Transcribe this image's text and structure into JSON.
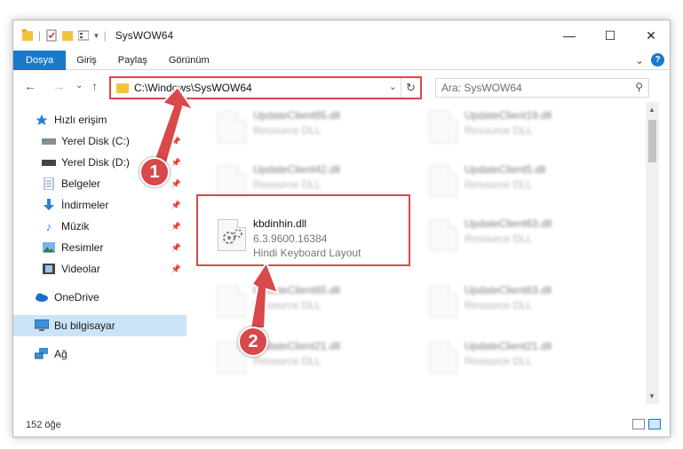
{
  "window": {
    "title": "SysWOW64",
    "controls": {
      "minimize": "—",
      "maximize": "☐",
      "close": "✕"
    }
  },
  "ribbon": {
    "tabs": [
      "Dosya",
      "Giriş",
      "Paylaş",
      "Görünüm"
    ],
    "active_tab": "Dosya",
    "expand": "⌄",
    "help": "?"
  },
  "navbar": {
    "back": "←",
    "forward": "→",
    "recent": "⌄",
    "up": "↑",
    "address": "C:\\Windows\\SysWOW64",
    "search_placeholder": "Ara: SysWOW64"
  },
  "sidebar": {
    "items": [
      {
        "label": "Hızlı erişim",
        "icon": "star-icon",
        "pinned": false
      },
      {
        "label": "Yerel Disk (C:)",
        "icon": "drive-icon",
        "pinned": true
      },
      {
        "label": "Yerel Disk (D:)",
        "icon": "drive-icon",
        "pinned": true
      },
      {
        "label": "Belgeler",
        "icon": "document-icon",
        "pinned": true
      },
      {
        "label": "İndirmeler",
        "icon": "download-icon",
        "pinned": true
      },
      {
        "label": "Müzik",
        "icon": "music-icon",
        "pinned": true
      },
      {
        "label": "Resimler",
        "icon": "pictures-icon",
        "pinned": true
      },
      {
        "label": "Videolar",
        "icon": "video-icon",
        "pinned": true
      },
      {
        "label": "OneDrive",
        "icon": "cloud-icon",
        "pinned": false
      },
      {
        "label": "Bu bilgisayar",
        "icon": "computer-icon",
        "pinned": false,
        "selected": true
      },
      {
        "label": "Ağ",
        "icon": "network-icon",
        "pinned": false
      }
    ]
  },
  "files": {
    "col1": [
      {
        "name": "UpdateClient65.dll",
        "desc": "Resource DLL"
      },
      {
        "name": "UpdateClient42.dll",
        "desc": "Resource DLL"
      },
      {
        "name": "kbdinhin.dll",
        "version": "6.3.9600.16384",
        "desc": "Hindi Keyboard Layout",
        "highlighted": true
      },
      {
        "name": "UpdateClient65.dll",
        "desc": "Resource DLL"
      },
      {
        "name": "UpdateClient21.dll",
        "desc": "Resource DLL"
      }
    ],
    "col2": [
      {
        "name": "UpdateClient19.dll",
        "desc": "Resource DLL"
      },
      {
        "name": "UpdateClient5.dll",
        "desc": "Resource DLL"
      },
      {
        "name": "UpdateClient63.dll",
        "desc": "Resource DLL"
      },
      {
        "name": "UpdateClient63.dll",
        "desc": "Resource DLL"
      },
      {
        "name": "UpdateClient21.dll",
        "desc": "Resource DLL"
      }
    ]
  },
  "status": {
    "item_count": "152 öğe"
  },
  "callouts": {
    "one": "1",
    "two": "2"
  },
  "colors": {
    "accent": "#1979ca",
    "annotation": "#d9484a",
    "selected_bg": "#cce4f7"
  }
}
